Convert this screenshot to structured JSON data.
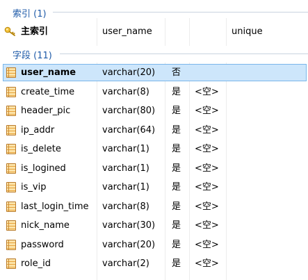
{
  "indexes_section": {
    "label": "索引 (1)"
  },
  "indexes": [
    {
      "name": "主索引",
      "field": "user_name",
      "type": "unique"
    }
  ],
  "fields_section": {
    "label": "字段 (11)"
  },
  "fields": [
    {
      "name": "user_name",
      "type": "varchar(20)",
      "nullable": "否",
      "default": ""
    },
    {
      "name": "create_time",
      "type": "varchar(8)",
      "nullable": "是",
      "default": "<空>"
    },
    {
      "name": "header_pic",
      "type": "varchar(80)",
      "nullable": "是",
      "default": "<空>"
    },
    {
      "name": "ip_addr",
      "type": "varchar(64)",
      "nullable": "是",
      "default": "<空>"
    },
    {
      "name": "is_delete",
      "type": "varchar(1)",
      "nullable": "是",
      "default": "<空>"
    },
    {
      "name": "is_logined",
      "type": "varchar(1)",
      "nullable": "是",
      "default": "<空>"
    },
    {
      "name": "is_vip",
      "type": "varchar(1)",
      "nullable": "是",
      "default": "<空>"
    },
    {
      "name": "last_login_time",
      "type": "varchar(8)",
      "nullable": "是",
      "default": "<空>"
    },
    {
      "name": "nick_name",
      "type": "varchar(30)",
      "nullable": "是",
      "default": "<空>"
    },
    {
      "name": "password",
      "type": "varchar(20)",
      "nullable": "是",
      "default": "<空>"
    },
    {
      "name": "role_id",
      "type": "varchar(2)",
      "nullable": "是",
      "default": "<空>"
    }
  ],
  "selected_field": "user_name",
  "icons": {
    "index": "key-icon",
    "field": "field-icon"
  },
  "colors": {
    "section_label": "#1e5aa8",
    "selection_bg": "#cde6fb",
    "selection_border": "#7ab6ea"
  }
}
